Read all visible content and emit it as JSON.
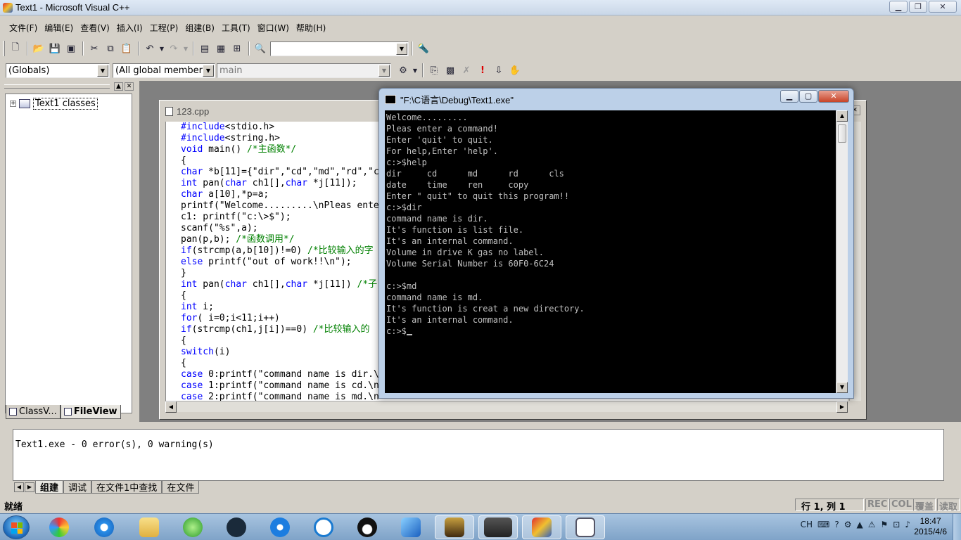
{
  "window": {
    "title": "Text1 - Microsoft Visual C++"
  },
  "menu": [
    "文件(F)",
    "编辑(E)",
    "查看(V)",
    "插入(I)",
    "工程(P)",
    "组建(B)",
    "工具(T)",
    "窗口(W)",
    "帮助(H)"
  ],
  "wizard": {
    "globals": "(Globals)",
    "members": "(All global members",
    "function": "main"
  },
  "left_pane": {
    "tree_root": "Text1 classes",
    "tabs": [
      "ClassV...",
      "FileView"
    ]
  },
  "editor": {
    "filename": "123.cpp",
    "lines": [
      "#include<stdio.h>",
      "#include<string.h>",
      "void main() /*主函数*/",
      "{",
      "char *b[11]={\"dir\",\"cd\",\"md\",\"rd\",\"c",
      "int pan(char ch1[],char *j[11]);",
      "char a[10],*p=a;",
      "printf(\"Welcome.........\\nPleas ente",
      "c1: printf(\"c:\\>$\");",
      "scanf(\"%s\",a);",
      "pan(p,b); /*函数调用*/",
      "if(strcmp(a,b[10])!=0) /*比较输入的字",
      "else printf(\"out of work!!\\n\");",
      "}",
      "int pan(char ch1[],char *j[11]) /*子",
      "{",
      "int i;",
      "for( i=0;i<11;i++)",
      "if(strcmp(ch1,j[i])==0) /*比较输入的",
      "{",
      "switch(i)",
      "{",
      "case 0:printf(\"command name is dir.\\",
      "case 1:printf(\"command name is cd.\\n",
      "case 2:printf(\"command name is md.\\n"
    ]
  },
  "console": {
    "title": "\"F:\\C语言\\Debug\\Text1.exe\"",
    "lines": [
      "Welcome.........",
      "Pleas enter a command!",
      "Enter 'quit' to quit.",
      "For help,Enter 'help'.",
      "c:>$help",
      "dir     cd      md      rd      cls",
      "date    time    ren     copy",
      "Enter \" quit\" to quit this program!!",
      "c:>$dir",
      "command name is dir.",
      "It's function is list file.",
      "It's an internal command.",
      "Volume in drive K gas no label.",
      "Volume Serial Number is 60F0-6C24",
      "",
      "c:>$md",
      "command name is md.",
      "It's function is creat a new directory.",
      "It's an internal command.",
      "c:>$"
    ]
  },
  "output": {
    "message": "Text1.exe - 0 error(s), 0 warning(s)",
    "tabs": [
      "组建",
      "调试",
      "在文件1中查找",
      "在文件"
    ]
  },
  "status": {
    "ready": "就绪",
    "position": "行 1, 列 1",
    "indicators": [
      "REC",
      "COL",
      "覆盖",
      "读取"
    ]
  },
  "taskbar": {
    "tray_lang": "CH",
    "time": "18:47",
    "date": "2015/4/6"
  },
  "colors": {
    "keyword": "#0000ff",
    "comment": "#008000",
    "console_bg": "#000000"
  }
}
